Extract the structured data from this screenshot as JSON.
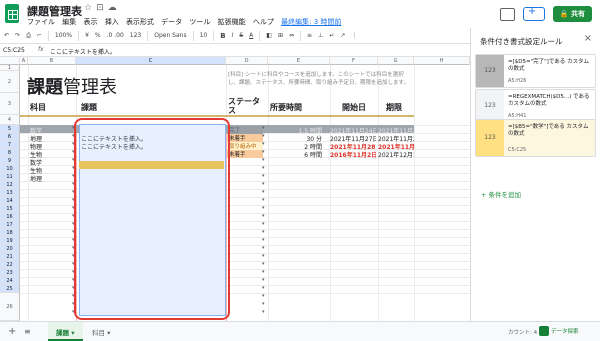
{
  "app": {
    "doc_title": "課題管理表",
    "menu": [
      "ファイル",
      "編集",
      "表示",
      "挿入",
      "表示形式",
      "データ",
      "ツール",
      "拡張機能",
      "ヘルプ"
    ],
    "last_edit": "最終編集: 3 時間前",
    "share_label": "共有"
  },
  "toolbar": {
    "zoom": "100%",
    "currency": "¥",
    "percent": "%",
    "decimals": ".0  .00",
    "format_123": "123",
    "font": "Open Sans",
    "font_size": "10",
    "bold": "B",
    "italic": "I",
    "strike": "S",
    "text_color": "A"
  },
  "formula_bar": {
    "name_box": "C5:C25",
    "fx": "fx",
    "value": "ここにテキストを挿入。"
  },
  "grid": {
    "columns": [
      "A",
      "B",
      "C",
      "D",
      "E",
      "F",
      "G",
      "H"
    ],
    "rows": [
      "1",
      "2",
      "3",
      "4",
      "5",
      "6",
      "7",
      "8",
      "9",
      "10",
      "11",
      "12",
      "13",
      "14",
      "15",
      "16",
      "17",
      "18",
      "19",
      "20",
      "21",
      "22",
      "23",
      "24",
      "25",
      "26"
    ],
    "title_bold": "課題",
    "title_light": "管理表",
    "description": "[科目] シートに科目やコースを追加します。このシートでは科目を選択し、課題、ステータス、所要時間、取り組み予定日、期限を追加します。",
    "headers": {
      "subject": "科目",
      "task": "課題",
      "status": "ステータス",
      "duration": "所要時間",
      "start": "開始日",
      "due": "期限"
    },
    "data_rows": [
      {
        "subject": "数学",
        "task": "ここにテキストを挿入。",
        "status": "完了",
        "duration": "1.5 時間",
        "start": "2021年11月24日",
        "due": "2021年11月26日"
      },
      {
        "subject": "地理",
        "task": "ここにテキストを挿入。",
        "status": "未着手",
        "duration": "30 分",
        "start": "2021年11月27日",
        "due": "2021年11月29日"
      },
      {
        "subject": "物理",
        "task": "ここにテキストを挿入。",
        "status": "取り組み中",
        "duration": "2 時間",
        "start": "2021年11月28日",
        "due": "2021年11月30日"
      },
      {
        "subject": "生物",
        "task": "",
        "status": "未着手",
        "duration": "6 時間",
        "start": "2016年11月2日",
        "due": "2021年12月1日"
      },
      {
        "subject": "数学",
        "task": "",
        "status": "",
        "duration": "",
        "start": "",
        "due": ""
      },
      {
        "subject": "生物",
        "task": "",
        "status": "",
        "duration": "",
        "start": "",
        "due": ""
      },
      {
        "subject": "地理",
        "task": "",
        "status": "",
        "duration": "",
        "start": "",
        "due": ""
      }
    ]
  },
  "panel": {
    "title": "条件付き書式設定ルール",
    "close": "×",
    "rules": [
      {
        "preview": "123",
        "text": "=[$D5=\"完了\"]である カスタムの数式",
        "range": "A5:H26",
        "color": "#b7b7b7"
      },
      {
        "preview": "123",
        "text": "=REGEXMATCH($D5...) であるカスタムの数式",
        "range": "A5:H41",
        "color": "#f1f3f4"
      },
      {
        "preview": "123",
        "text": "=[$B5=\"数学\"]である カスタムの数式",
        "range": "C5:C25",
        "color": "#ffe082"
      }
    ],
    "add_rule": "+ 条件を追加"
  },
  "bottom": {
    "add": "+",
    "list": "≡",
    "tab_active": "課題",
    "tab_other": "科目",
    "count": "カウント: 4",
    "explore": "データ探索"
  },
  "colors": {
    "accent_green": "#1e8e3e",
    "selection": "#e8efff",
    "red_outline": "#e53935",
    "done_row": "#a0a6ad",
    "math_row": "#e6c35c"
  }
}
